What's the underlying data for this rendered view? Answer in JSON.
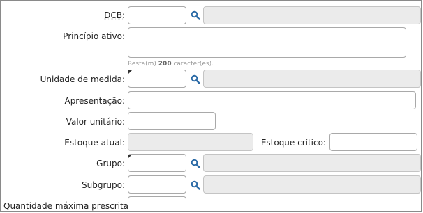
{
  "form": {
    "dcb_label": "DCB:",
    "principio_label": "Princípio ativo:",
    "principio_hint_prefix": "Resta(m)",
    "principio_hint_count": "200",
    "principio_hint_suffix": "caracter(es).",
    "unidade_label": "Unidade de medida:",
    "apresentacao_label": "Apresentação:",
    "valor_label": "Valor unitário:",
    "estoque_atual_label": "Estoque atual:",
    "estoque_critico_label": "Estoque crítico:",
    "grupo_label": "Grupo:",
    "subgrupo_label": "Subgrupo:",
    "quantidade_label": "Quantidade máxima prescrita:"
  },
  "icons": {
    "search": "search-icon"
  },
  "colors": {
    "search_icon": "#2a6aa6",
    "readonly_field": "#ebebeb"
  }
}
